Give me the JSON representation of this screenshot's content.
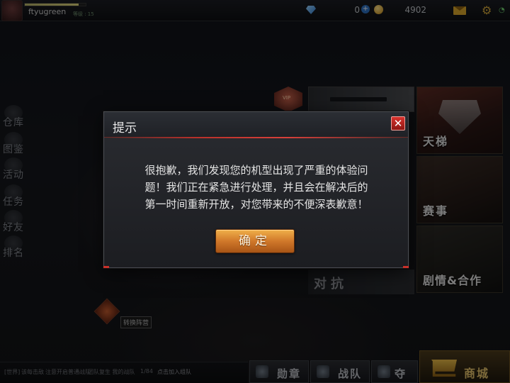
{
  "topbar": {
    "username": "ftyugreen",
    "level_label": "等级 : 15",
    "exp_progress": 0.88,
    "diamonds": "0",
    "diamond_add": "+",
    "coins": "4902"
  },
  "sidebar": {
    "items": [
      {
        "label": "仓库",
        "icon": "warehouse-icon"
      },
      {
        "label": "图鉴",
        "icon": "codex-icon"
      },
      {
        "label": "活动",
        "icon": "event-icon"
      },
      {
        "label": "任务",
        "icon": "task-icon"
      },
      {
        "label": "好友",
        "icon": "friends-icon"
      },
      {
        "label": "排名",
        "icon": "ranking-icon"
      }
    ]
  },
  "modes": {
    "ladder": "天梯",
    "event": "赛事",
    "story": "剧情&合作",
    "versus": "对抗"
  },
  "switch_team": "转换阵营",
  "chat": {
    "channel": "[世界]",
    "name": "该每击敌",
    "msg": "注意开启普通战队",
    "msg2": "团队复生 我的战队",
    "count": "1/84",
    "join": "点击加入组队"
  },
  "bottom_nav": [
    {
      "label": "勋章",
      "icon": "medal-icon"
    },
    {
      "label": "战队",
      "icon": "team-icon"
    },
    {
      "label": "夺宝",
      "icon": "treasure-icon"
    },
    {
      "label": "商城",
      "icon": "cart-icon"
    }
  ],
  "dialog": {
    "title": "提示",
    "lines": [
      "很抱歉，我们发现您的机型出现了严重的体验问",
      "题！我们正在紧急进行处理，并且会在解决后的",
      "第一时间重新开放，对您带来的不便深表歉意！"
    ],
    "confirm_label": "确定",
    "close_symbol": "✕"
  },
  "colors": {
    "accent_red": "#b8302a",
    "confirm_orange": "#d0782a",
    "gold": "#d2a63a"
  }
}
